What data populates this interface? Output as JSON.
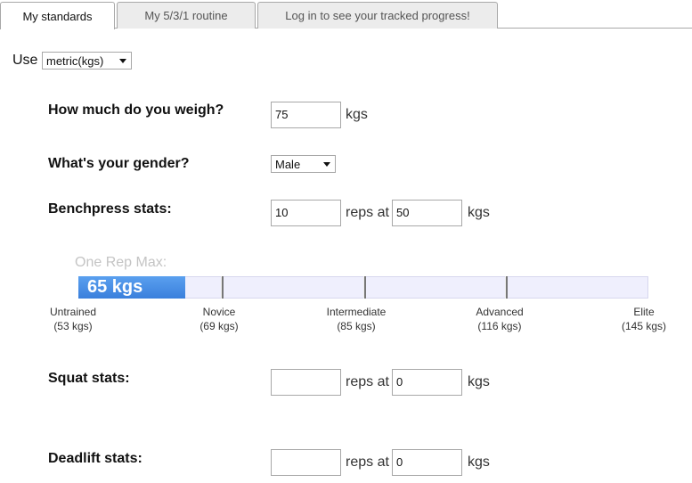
{
  "tabs": [
    {
      "label": "My standards"
    },
    {
      "label": "My 5/3/1 routine"
    },
    {
      "label": "Log in to see your tracked progress!"
    }
  ],
  "units": {
    "label": "Use",
    "selected": "metric(kgs)"
  },
  "weight": {
    "question": "How much do you weigh?",
    "value": "75",
    "unit": "kgs"
  },
  "gender": {
    "question": "What's your gender?",
    "selected": "Male"
  },
  "bench": {
    "question": "Benchpress stats:",
    "reps": "10",
    "reps_label": "reps at",
    "weight": "50",
    "unit": "kgs"
  },
  "one_rep_max": {
    "label": "One Rep Max:",
    "value_text": "65 kgs",
    "value": 65,
    "levels": [
      {
        "name": "Untrained",
        "value": "(53 kgs)"
      },
      {
        "name": "Novice",
        "value": "(69 kgs)"
      },
      {
        "name": "Intermediate",
        "value": "(85 kgs)"
      },
      {
        "name": "Advanced",
        "value": "(116 kgs)"
      },
      {
        "name": "Elite",
        "value": "(145 kgs)"
      }
    ]
  },
  "squat": {
    "question": "Squat stats:",
    "reps": "",
    "reps_label": "reps at",
    "weight": "0",
    "unit": "kgs"
  },
  "deadlift": {
    "question": "Deadlift stats:",
    "reps": "",
    "reps_label": "reps at",
    "weight": "0",
    "unit": "kgs"
  },
  "colors": {
    "bar_fill": "#3a7fdc",
    "bar_track": "#efeffd"
  }
}
